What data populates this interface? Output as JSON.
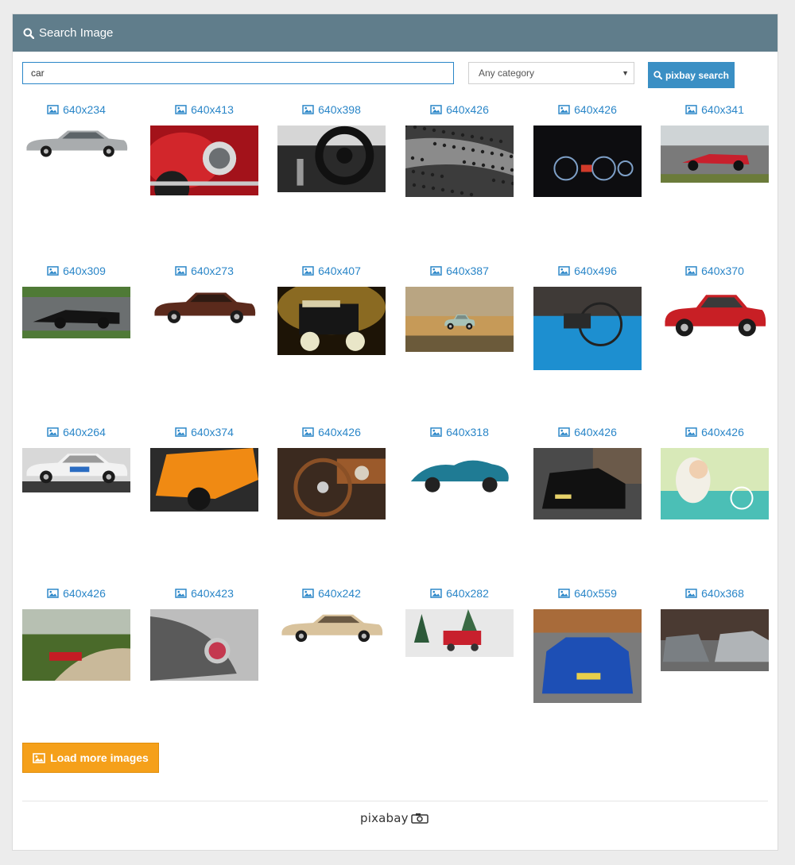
{
  "header": {
    "title": "Search Image"
  },
  "search": {
    "value": "car"
  },
  "category": {
    "selected": "Any category"
  },
  "search_button": {
    "label": "pixbay search"
  },
  "results": [
    {
      "size": "640x234",
      "kind": "car-silver-classic",
      "ratio": 0.37
    },
    {
      "size": "640x413",
      "kind": "car-red-headlight",
      "ratio": 0.65
    },
    {
      "size": "640x398",
      "kind": "steering-dark",
      "ratio": 0.62
    },
    {
      "size": "640x426",
      "kind": "raindrops",
      "ratio": 0.665
    },
    {
      "size": "640x426",
      "kind": "dashboard",
      "ratio": 0.665
    },
    {
      "size": "640x341",
      "kind": "race-red",
      "ratio": 0.53
    },
    {
      "size": "640x309",
      "kind": "race-black",
      "ratio": 0.48
    },
    {
      "size": "640x273",
      "kind": "car-brown-vintage",
      "ratio": 0.43
    },
    {
      "size": "640x407",
      "kind": "antique-yellow",
      "ratio": 0.635
    },
    {
      "size": "640x387",
      "kind": "toy-beach",
      "ratio": 0.6
    },
    {
      "size": "640x496",
      "kind": "blue-interior",
      "ratio": 0.775
    },
    {
      "size": "640x370",
      "kind": "car-red-classic",
      "ratio": 0.58
    },
    {
      "size": "640x264",
      "kind": "porsche-white",
      "ratio": 0.41
    },
    {
      "size": "640x374",
      "kind": "lamborghini-orange",
      "ratio": 0.585
    },
    {
      "size": "640x426",
      "kind": "wood-steering",
      "ratio": 0.665
    },
    {
      "size": "640x318",
      "kind": "teal-roadster",
      "ratio": 0.5
    },
    {
      "size": "640x426",
      "kind": "bmw-black",
      "ratio": 0.665
    },
    {
      "size": "640x426",
      "kind": "woman-convertible",
      "ratio": 0.665
    },
    {
      "size": "640x426",
      "kind": "red-car-trees",
      "ratio": 0.665
    },
    {
      "size": "640x423",
      "kind": "taillight",
      "ratio": 0.66
    },
    {
      "size": "640x242",
      "kind": "car-cream-vintage",
      "ratio": 0.38
    },
    {
      "size": "640x282",
      "kind": "christmas-truck",
      "ratio": 0.44
    },
    {
      "size": "640x559",
      "kind": "bmw-blue",
      "ratio": 0.87
    },
    {
      "size": "640x368",
      "kind": "bentley-street",
      "ratio": 0.575
    }
  ],
  "load_more": {
    "label": "Load more images"
  },
  "footer": {
    "logo_text": "pixabay"
  },
  "colors": {
    "header": "#607d8b",
    "accent": "#2a86c8",
    "load_more": "#f5a01a"
  }
}
